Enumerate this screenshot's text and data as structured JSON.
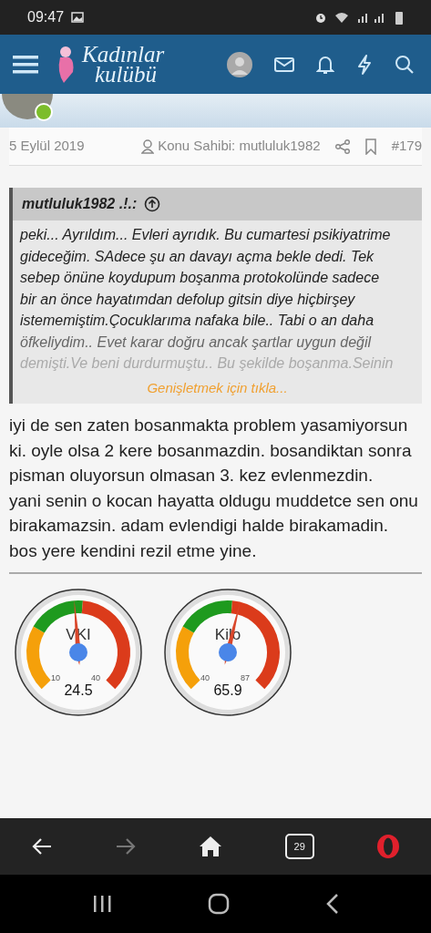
{
  "status_bar": {
    "time": "09:47"
  },
  "site": {
    "logo_line1": "Kadınlar",
    "logo_line2": "kulübü"
  },
  "post": {
    "date": "5 Eylül 2019",
    "author_label": "Konu Sahibi: mutluluk1982",
    "number": "#179",
    "quote": {
      "author": "mutluluk1982 .!.:",
      "lines": [
        "peki... Ayrıldım... Evleri ayrıdık. Bu cumartesi psikiyatrime",
        "gideceğim. SAdece şu an davayı açma bekle dedi. Tek",
        "sebep önüne koydupum boşanma protokolünde sadece",
        "bir an önce hayatımdan defolup gitsin diye hiçbirşey",
        "istememiştim.Çocuklarıma nafaka bile.. Tabi o an daha",
        "öfkeliydim.. Evet karar doğru ancak şartlar uygun değil",
        "demişti.Ve beni durdurmuştu.. Bu şekilde boşanma.Seinin"
      ],
      "expand": "Genişletmek için tıkla..."
    },
    "body": [
      "iyi de sen zaten bosanmakta problem yasamiyorsun ki. oyle olsa 2 kere bosanmazdin. bosandiktan sonra pisman oluyorsun olmasan 3. kez evlenmezdin.",
      "yani senin o kocan hayatta oldugu muddetce sen onu birakamazsin. adam evlendigi halde birakamadin.",
      "bos yere kendini rezil etme yine."
    ]
  },
  "gauges": [
    {
      "label": "VKI",
      "min": "10",
      "max": "40",
      "reading": "24.5"
    },
    {
      "label": "Kilo",
      "min": "40",
      "max": "87",
      "reading": "65.9"
    }
  ],
  "browser_bar": {
    "tab_count": "29"
  }
}
